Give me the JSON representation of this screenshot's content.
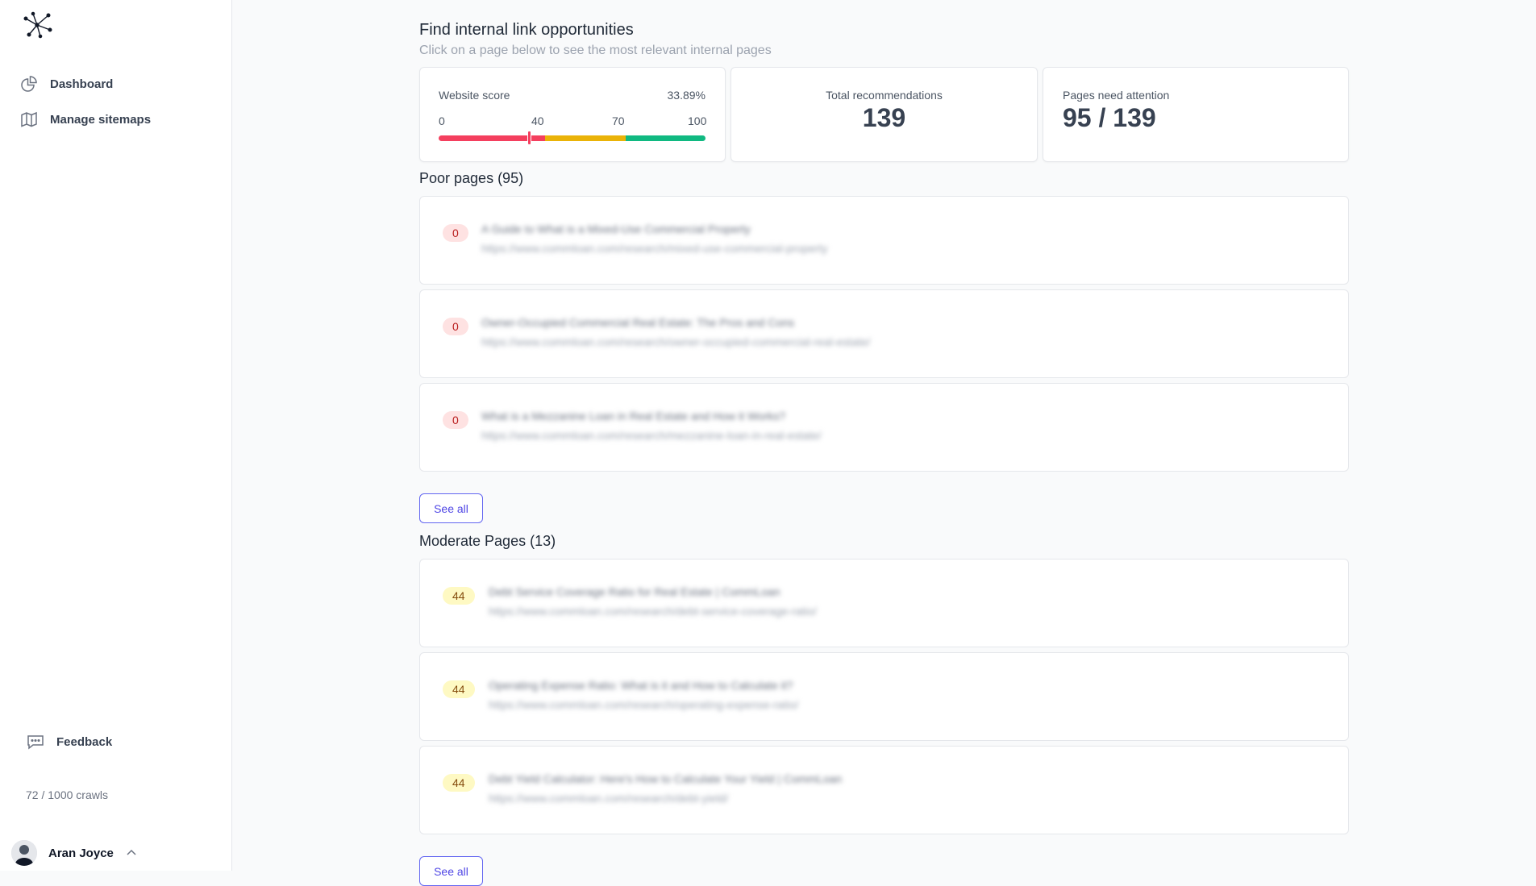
{
  "sidebar": {
    "nav": {
      "dashboard": "Dashboard",
      "sitemaps": "Manage sitemaps"
    },
    "feedback": "Feedback",
    "crawls": "72 / 1000 crawls",
    "user_name": "Aran Joyce"
  },
  "header": {
    "title": "Find internal link opportunities",
    "subtitle": "Click on a page below to see the most relevant internal pages"
  },
  "stats": {
    "website_score_label": "Website score",
    "website_score_value": "33.89%",
    "website_score_percent": 33.89,
    "ticks": [
      "0",
      "40",
      "70",
      "100"
    ],
    "total_label": "Total recommendations",
    "total_value": "139",
    "attention_label": "Pages need attention",
    "attention_value": "95 / 139"
  },
  "colors": {
    "poor": "#f43f5e",
    "moderate": "#eab308",
    "good": "#10b981",
    "accent": "#4f46e5"
  },
  "poor_section": {
    "title": "Poor pages (95)",
    "see_all": "See all",
    "rows": [
      {
        "score": "0",
        "title": "A Guide to What is a Mixed-Use Commercial Property",
        "url": "https://www.commloan.com/research/mixed-use-commercial-property"
      },
      {
        "score": "0",
        "title": "Owner-Occupied Commercial Real Estate: The Pros and Cons",
        "url": "https://www.commloan.com/research/owner-occupied-commercial-real-estate/"
      },
      {
        "score": "0",
        "title": "What is a Mezzanine Loan in Real Estate and How it Works?",
        "url": "https://www.commloan.com/research/mezzanine-loan-in-real-estate/"
      }
    ]
  },
  "moderate_section": {
    "title": "Moderate Pages (13)",
    "see_all": "See all",
    "rows": [
      {
        "score": "44",
        "title": "Debt Service Coverage Ratio for Real Estate | CommLoan",
        "url": "https://www.commloan.com/research/debt-service-coverage-ratio/"
      },
      {
        "score": "44",
        "title": "Operating Expense Ratio: What is it and How to Calculate it?",
        "url": "https://www.commloan.com/research/operating-expense-ratio/"
      },
      {
        "score": "44",
        "title": "Debt Yield Calculator: Here's How to Calculate Your Yield | CommLoan",
        "url": "https://www.commloan.com/research/debt-yield/"
      }
    ]
  }
}
